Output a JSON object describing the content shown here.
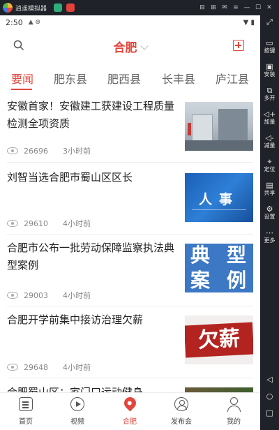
{
  "emulator": {
    "title": "逍遥模拟器",
    "controls": [
      "⊟",
      "⊞",
      "✉",
      "≡",
      "—",
      "☐",
      "✕"
    ],
    "sidebar": [
      {
        "glyph": "⤢",
        "label": ""
      },
      {
        "glyph": "▭",
        "label": "按键"
      },
      {
        "glyph": "▣",
        "label": "安装"
      },
      {
        "glyph": "⧉",
        "label": "多开"
      },
      {
        "glyph": "◁+",
        "label": "加量"
      },
      {
        "glyph": "◁-",
        "label": "减量"
      },
      {
        "glyph": "⌖",
        "label": "定位"
      },
      {
        "glyph": "▤",
        "label": "共享"
      },
      {
        "glyph": "⚙",
        "label": "设置"
      },
      {
        "glyph": "⋯",
        "label": "更多"
      },
      {
        "glyph": "◁",
        "label": ""
      },
      {
        "glyph": "○",
        "label": ""
      },
      {
        "glyph": "□",
        "label": ""
      }
    ]
  },
  "statusbar": {
    "time": "2:50",
    "icons": "▲ ⊕",
    "right": "▼ ▮"
  },
  "header": {
    "city": "合肥",
    "search_icon": "search-icon",
    "add_icon": "add-icon"
  },
  "tabs": [
    {
      "label": "要闻",
      "active": true
    },
    {
      "label": "肥东县",
      "active": false
    },
    {
      "label": "肥西县",
      "active": false
    },
    {
      "label": "长丰县",
      "active": false
    },
    {
      "label": "庐江县",
      "active": false
    }
  ],
  "articles": [
    {
      "title": "安徽首家！安徽建工获建设工程质量检测全项资质",
      "views": "26696",
      "time": "3小时前"
    },
    {
      "title": "刘智当选合肥市蜀山区区长",
      "views": "29610",
      "time": "4小时前",
      "thumb_text": "人事"
    },
    {
      "title": "合肥市公布一批劳动保障监察执法典型案例",
      "views": "29003",
      "time": "4小时前",
      "thumb_text": [
        "典",
        "型",
        "案",
        "例"
      ]
    },
    {
      "title": "合肥开学前集中接访治理欠薪",
      "views": "29648",
      "time": "4小时前",
      "thumb_text": "欠薪"
    },
    {
      "title": "合肥蜀山区：家门口运动健身",
      "views": "",
      "time": ""
    }
  ],
  "bottomnav": [
    {
      "label": "首页",
      "icon": "home-icon",
      "active": false
    },
    {
      "label": "视频",
      "icon": "video-icon",
      "active": false
    },
    {
      "label": "合肥",
      "icon": "location-pin-icon",
      "active": true
    },
    {
      "label": "发布会",
      "icon": "conference-icon",
      "active": false
    },
    {
      "label": "我的",
      "icon": "profile-icon",
      "active": false
    }
  ],
  "colors": {
    "accent": "#e1473d",
    "emulator_bg": "#1f2228"
  }
}
